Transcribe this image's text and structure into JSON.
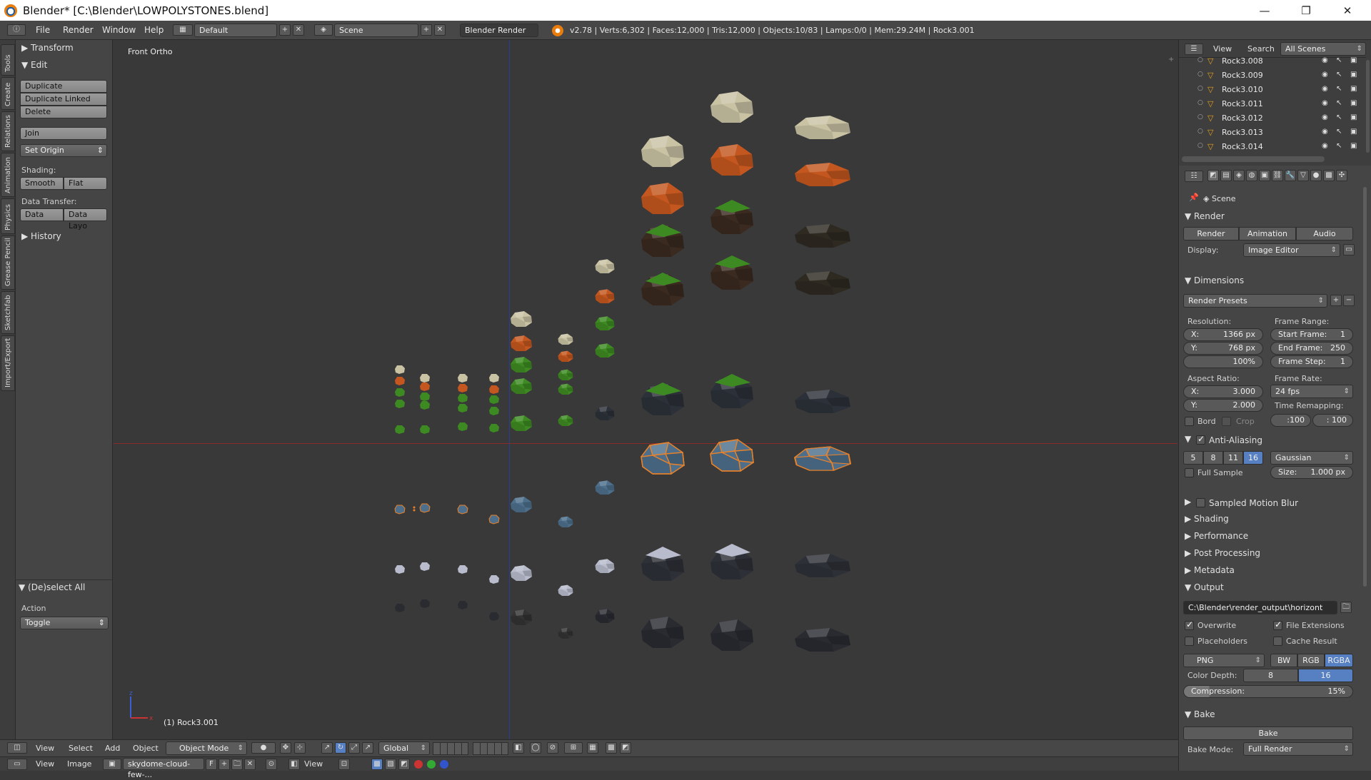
{
  "window": {
    "title": "Blender* [C:\\Blender\\LOWPOLYSTONES.blend]",
    "controls": {
      "minimize": "—",
      "maximize": "❐",
      "close": "✕"
    }
  },
  "topbar": {
    "menus": [
      "File",
      "Render",
      "Window",
      "Help"
    ],
    "layout": "Default",
    "scene": "Scene",
    "engine": "Blender Render",
    "stats": "v2.78 | Verts:6,302 | Faces:12,000 | Tris:12,000 | Objects:10/83 | Lamps:0/0 | Mem:29.24M | Rock3.001"
  },
  "vtabs": [
    "Tools",
    "Create",
    "Relations",
    "Animation",
    "Physics",
    "Grease Pencil",
    "Sketchfab",
    "Import/Export"
  ],
  "toolshelf": {
    "transform": "Transform",
    "edit": "Edit",
    "buttons": [
      "Duplicate",
      "Duplicate Linked",
      "Delete"
    ],
    "join": "Join",
    "set_origin": "Set Origin",
    "shading_label": "Shading:",
    "smooth": "Smooth",
    "flat": "Flat",
    "data_transfer_label": "Data Transfer:",
    "data": "Data",
    "data_layo": "Data Layo",
    "history": "History",
    "deselect_all": "(De)select All",
    "action_label": "Action",
    "action_value": "Toggle"
  },
  "viewport": {
    "view_name": "Front Ortho",
    "active_object": "(1) Rock3.001"
  },
  "outliner": {
    "view": "View",
    "search": "Search",
    "scene_filter": "All Scenes",
    "rows": [
      "Rock3.008",
      "Rock3.009",
      "Rock3.010",
      "Rock3.011",
      "Rock3.012",
      "Rock3.013",
      "Rock3.014"
    ]
  },
  "properties": {
    "context": "Scene",
    "render_section": "Render",
    "render_btn": "Render",
    "animation_btn": "Animation",
    "audio_btn": "Audio",
    "display_label": "Display:",
    "display_value": "Image Editor",
    "dimensions": "Dimensions",
    "render_presets": "Render Presets",
    "resolution_label": "Resolution:",
    "res_x_key": "X:",
    "res_x": "1366 px",
    "res_y_key": "Y:",
    "res_y": "768 px",
    "res_pct": "100%",
    "frame_range_label": "Frame Range:",
    "start_key": "Start Frame:",
    "start": "1",
    "end_key": "End Frame:",
    "end": "250",
    "step_key": "Frame Step:",
    "step": "1",
    "aspect_label": "Aspect Ratio:",
    "asp_x_key": "X:",
    "asp_x": "3.000",
    "asp_y_key": "Y:",
    "asp_y": "2.000",
    "frame_rate_label": "Frame Rate:",
    "frame_rate": "24 fps",
    "time_remap_label": "Time Remapping:",
    "remap_old": ":100",
    "remap_new": ": 100",
    "bord": "Bord",
    "crop": "Crop",
    "anti_aliasing": "Anti-Aliasing",
    "aa_samples": [
      "5",
      "8",
      "11",
      "16"
    ],
    "aa_filter": "Gaussian",
    "full_sample": "Full Sample",
    "size_key": "Size:",
    "size": "1.000 px",
    "sampled_motion_blur": "Sampled Motion Blur",
    "shading": "Shading",
    "performance": "Performance",
    "post_processing": "Post Processing",
    "metadata": "Metadata",
    "output": "Output",
    "output_path": "C:\\Blender\\render_output\\horizont",
    "overwrite": "Overwrite",
    "file_extensions": "File Extensions",
    "placeholders": "Placeholders",
    "cache_result": "Cache Result",
    "format": "PNG",
    "bw": "BW",
    "rgb": "RGB",
    "rgba": "RGBA",
    "color_depth_label": "Color Depth:",
    "depth_8": "8",
    "depth_16": "16",
    "compression_key": "Compression:",
    "compression": "15%",
    "bake_section": "Bake",
    "bake_btn": "Bake",
    "bake_mode_label": "Bake Mode:",
    "bake_mode": "Full Render"
  },
  "bottombar": {
    "view": "View",
    "select": "Select",
    "add": "Add",
    "object": "Object",
    "mode": "Object Mode",
    "orientation": "Global"
  },
  "bottombar2": {
    "view": "View",
    "image": "Image",
    "image_name": "skydome-cloud-few-...",
    "f": "F",
    "view2": "View"
  },
  "colors": {
    "accent_blue": "#5680c2",
    "selection_orange": "#e8822a",
    "rock_beige": "#c9c3a4",
    "rock_orange": "#c4571f",
    "rock_green": "#3e8a22",
    "rock_blue": "#4d6f8c",
    "rock_white": "#b8bccc",
    "rock_dark": "#2e2f36"
  }
}
